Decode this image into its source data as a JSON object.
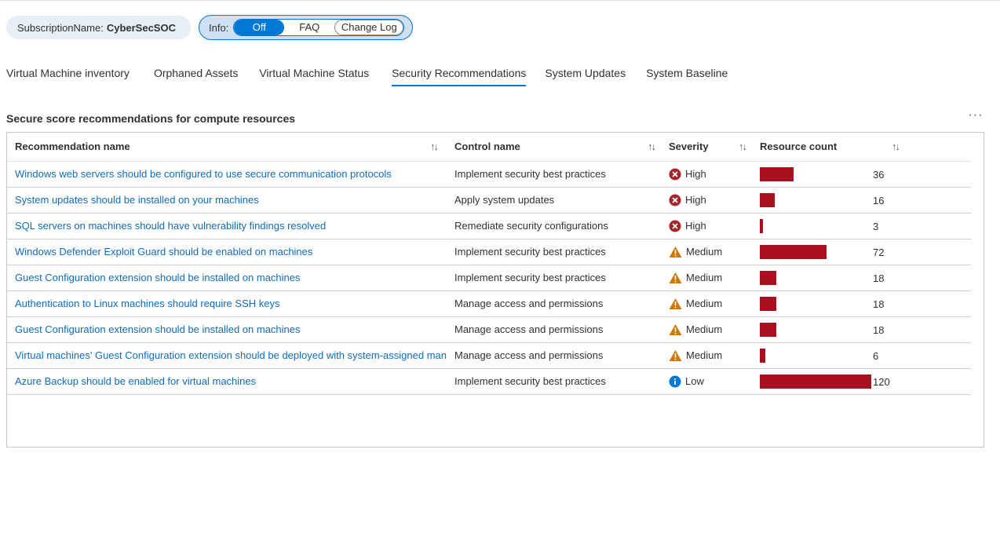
{
  "params": {
    "subscription": {
      "name": "SubscriptionName:",
      "value": "CyberSecSOC"
    },
    "info": {
      "label": "Info:",
      "options": [
        "Off",
        "FAQ",
        "Change Log"
      ],
      "selected": "Off"
    }
  },
  "tabs": [
    {
      "label": "Virtual Machine inventory",
      "active": false
    },
    {
      "label": "Orphaned Assets",
      "active": false
    },
    {
      "label": "Virtual Machine Status",
      "active": false
    },
    {
      "label": "Security Recommendations",
      "active": true
    },
    {
      "label": "System Updates",
      "active": false
    },
    {
      "label": "System Baseline",
      "active": false
    }
  ],
  "section": {
    "title": "Secure score recommendations for compute resources"
  },
  "grid": {
    "columns": [
      "Recommendation name",
      "Control name",
      "Severity",
      "Resource count"
    ],
    "bar_color": "#a80f1f",
    "max_count": 120,
    "rows": [
      {
        "name": "Windows web servers should be configured to use secure communication protocols",
        "control": "Implement security best practices",
        "severity": "High",
        "count": 36
      },
      {
        "name": "System updates should be installed on your machines",
        "control": "Apply system updates",
        "severity": "High",
        "count": 16
      },
      {
        "name": "SQL servers on machines should have vulnerability findings resolved",
        "control": "Remediate security configurations",
        "severity": "High",
        "count": 3
      },
      {
        "name": "Windows Defender Exploit Guard should be enabled on machines",
        "control": "Implement security best practices",
        "severity": "Medium",
        "count": 72
      },
      {
        "name": "Guest Configuration extension should be installed on machines",
        "control": "Implement security best practices",
        "severity": "Medium",
        "count": 18
      },
      {
        "name": "Authentication to Linux machines should require SSH keys",
        "control": "Manage access and permissions",
        "severity": "Medium",
        "count": 18
      },
      {
        "name": "Guest Configuration extension should be installed on machines",
        "control": "Manage access and permissions",
        "severity": "Medium",
        "count": 18
      },
      {
        "name": "Virtual machines' Guest Configuration extension should be deployed with system-assigned mana",
        "control": "Manage access and permissions",
        "severity": "Medium",
        "count": 6
      },
      {
        "name": "Azure Backup should be enabled for virtual machines",
        "control": "Implement security best practices",
        "severity": "Low",
        "count": 120
      }
    ]
  },
  "severity_icons": {
    "High": {
      "icon": "error-circle-icon",
      "color": "#a4262c"
    },
    "Medium": {
      "icon": "warning-triangle-icon",
      "color": "#d47500"
    },
    "Low": {
      "icon": "info-circle-icon",
      "color": "#0078d4"
    }
  }
}
